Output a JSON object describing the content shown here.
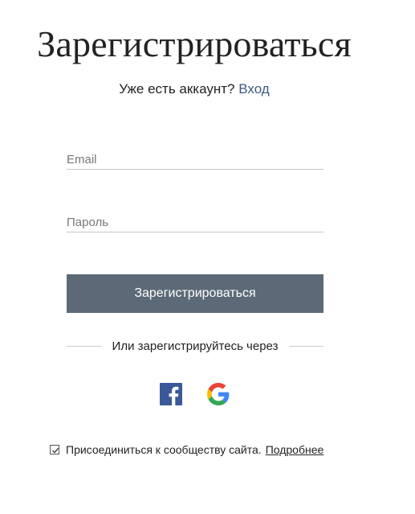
{
  "title": "Зарегистрироваться",
  "subtitle": {
    "text": "Уже есть аккаунт?",
    "login_link": "Вход"
  },
  "form": {
    "email": {
      "placeholder": "Email",
      "value": ""
    },
    "password": {
      "placeholder": "Пароль",
      "value": ""
    },
    "submit_label": "Зарегистрироваться"
  },
  "divider_text": "Или зарегистрируйтесь через",
  "social": [
    {
      "icon": "facebook-icon",
      "color": "#3b5998"
    },
    {
      "icon": "google-icon",
      "colors": [
        "#4285F4",
        "#EA4335",
        "#FBBC05",
        "#34A853"
      ]
    }
  ],
  "consent": {
    "checked": true,
    "text": "Присоединиться к сообществу сайта.",
    "more_link": "Подробнее"
  },
  "colors": {
    "button_bg": "#5c6a77",
    "link": "#3d5a80"
  }
}
